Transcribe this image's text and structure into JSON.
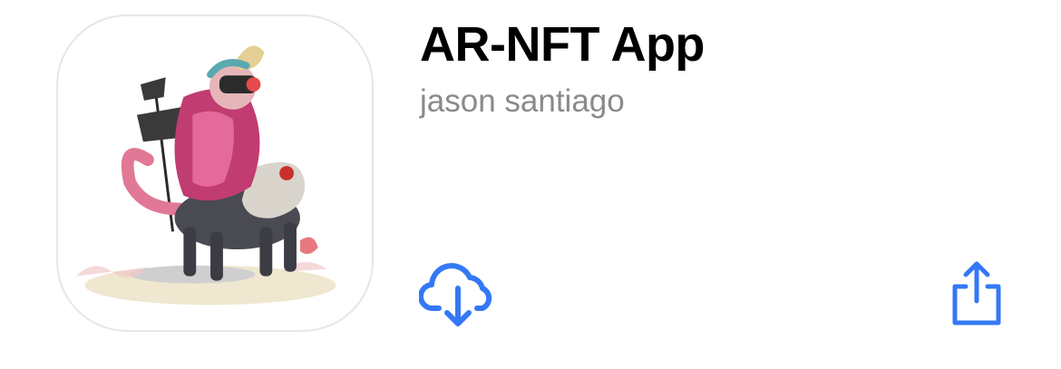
{
  "app": {
    "title": "AR-NFT App",
    "developer": "jason santiago"
  },
  "actions": {
    "download_icon": "cloud-download-icon",
    "share_icon": "share-icon"
  },
  "colors": {
    "accent": "#3478f6",
    "title": "#000000",
    "subtitle": "#8a8a8e",
    "icon_border": "#e6e6e6"
  }
}
